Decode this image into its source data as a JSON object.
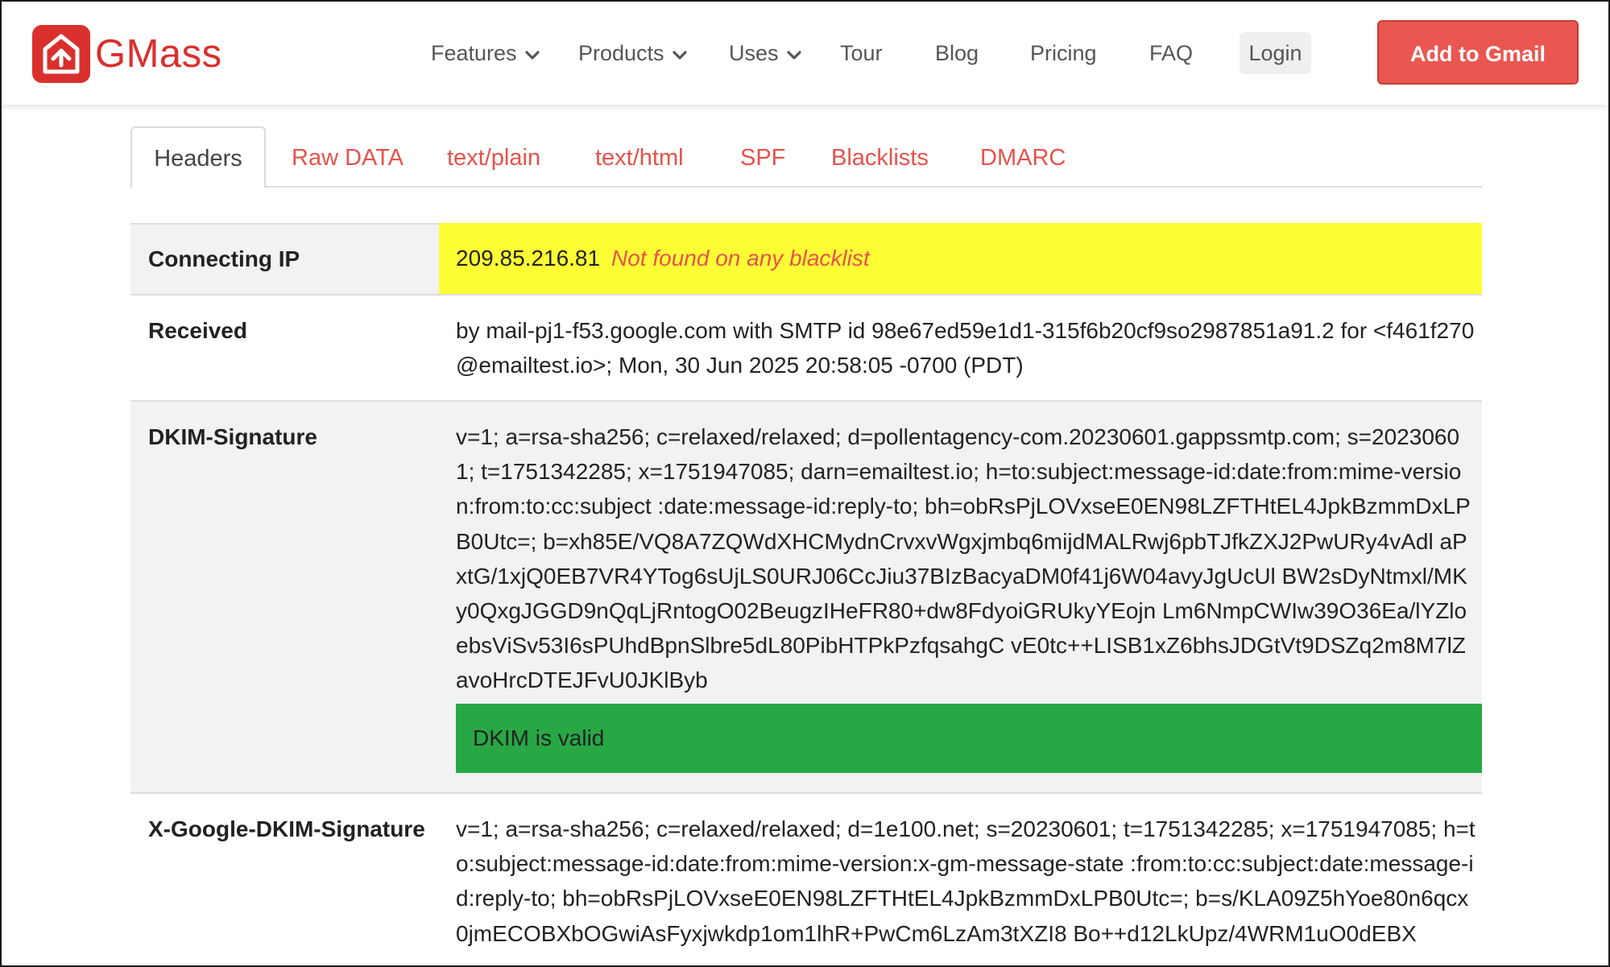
{
  "brand": {
    "name": "GMass",
    "color": "#d9302d"
  },
  "nav": {
    "items": [
      {
        "label": "Features",
        "has_dropdown": true
      },
      {
        "label": "Products",
        "has_dropdown": true
      },
      {
        "label": "Uses",
        "has_dropdown": true
      },
      {
        "label": "Tour",
        "has_dropdown": false
      },
      {
        "label": "Blog",
        "has_dropdown": false
      },
      {
        "label": "Pricing",
        "has_dropdown": false
      },
      {
        "label": "FAQ",
        "has_dropdown": false
      }
    ],
    "login_label": "Login",
    "cta_label": "Add to Gmail",
    "cta_color": "#ea5751"
  },
  "tabs": {
    "active": "Headers",
    "items": [
      "Headers",
      "Raw DATA",
      "text/plain",
      "text/html",
      "SPF",
      "Blacklists",
      "DMARC"
    ],
    "link_color": "#e5534c"
  },
  "headers": {
    "connecting_ip": {
      "label": "Connecting IP",
      "ip": "209.85.216.81",
      "status": "Not found on any blacklist",
      "highlight_color": "#fefe35"
    },
    "received": {
      "label": "Received",
      "value": "by mail-pj1-f53.google.com with SMTP id 98e67ed59e1d1-315f6b20cf9so2987851a91.2 for <f461f270@emailtest.io>; Mon, 30 Jun 2025 20:58:05 -0700 (PDT)"
    },
    "dkim_signature": {
      "label": "DKIM-Signature",
      "value": "v=1; a=rsa-sha256; c=relaxed/relaxed; d=pollentagency-com.20230601.gappssmtp.com; s=20230601; t=1751342285; x=1751947085; darn=emailtest.io; h=to:subject:message-id:date:from:mime-version:from:to:cc:subject :date:message-id:reply-to; bh=obRsPjLOVxseE0EN98LZFTHtEL4JpkBzmmDxLPB0Utc=; b=xh85E/VQ8A7ZQWdXHCMydnCrvxvWgxjmbq6mijdMALRwj6pbTJfkZXJ2PwURy4vAdl aPxtG/1xjQ0EB7VR4YTog6sUjLS0URJ06CcJiu37BIzBacyaDM0f41j6W04avyJgUcUl BW2sDyNtmxl/MKy0QxgJGGD9nQqLjRntogO02BeugzIHeFR80+dw8FdyoiGRUkyYEojn Lm6NmpCWIw39O36Ea/lYZloebsViSv53I6sPUhdBpnSlbre5dL80PibHTPkPzfqsahgC vE0tc++LISB1xZ6bhsJDGtVt9DSZq2m8M7lZavoHrcDTEJFvU0JKlByb",
      "status": "DKIM is valid",
      "status_color": "#28a745"
    },
    "x_google_dkim_signature": {
      "label": "X-Google-DKIM-Signature",
      "value": "v=1; a=rsa-sha256; c=relaxed/relaxed; d=1e100.net; s=20230601; t=1751342285; x=1751947085; h=to:subject:message-id:date:from:mime-version:x-gm-message-state :from:to:cc:subject:date:message-id:reply-to; bh=obRsPjLOVxseE0EN98LZFTHtEL4JpkBzmmDxLPB0Utc=; b=s/KLA09Z5hYoe80n6qcx0jmECOBXbOGwiAsFyxjwkdp1om1lhR+PwCm6LzAm3tXZI8 Bo++d12LkUpz/4WRM1uO0dEBX"
    }
  },
  "icons": {
    "logo": "envelope-logo-icon",
    "dropdown": "chevron-down-icon"
  }
}
